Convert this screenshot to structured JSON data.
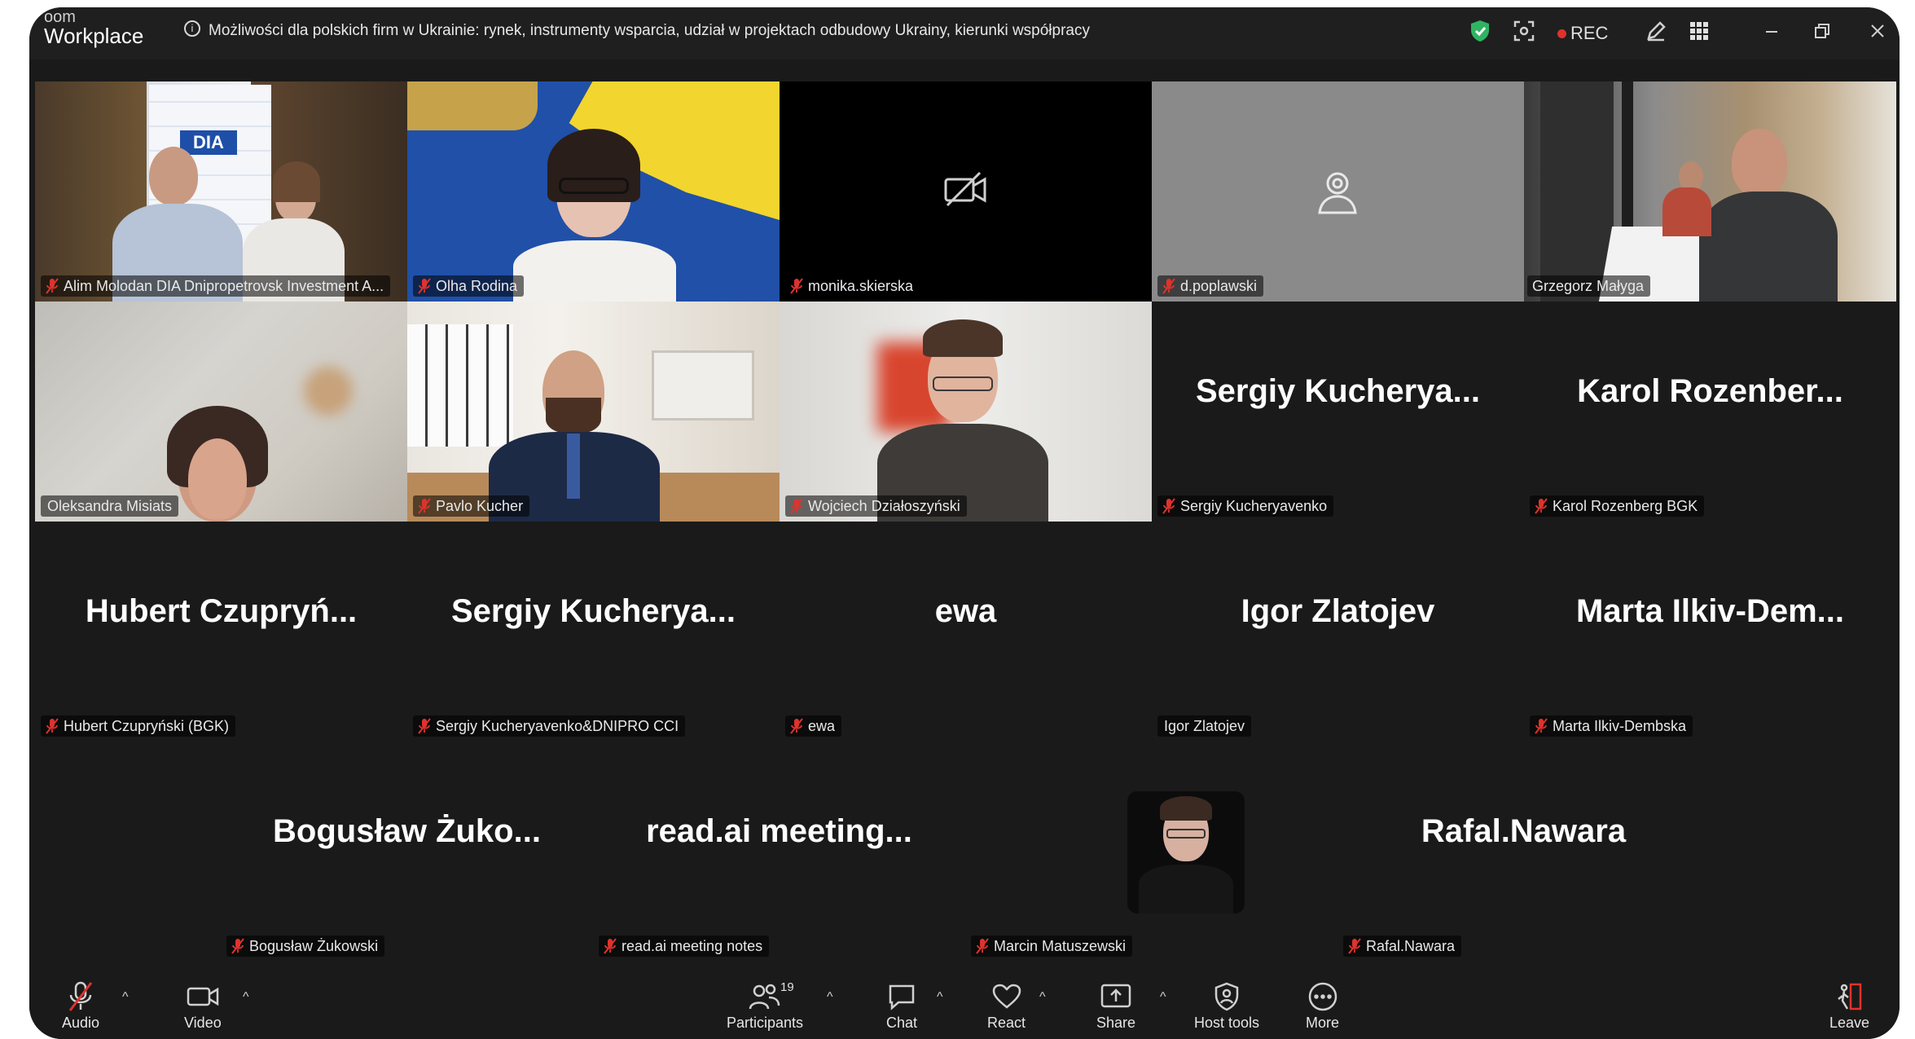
{
  "app": {
    "brand_top": "oom",
    "brand_bottom": "Workplace"
  },
  "meeting": {
    "topic": "Możliwości dla polskich firm w Ukrainie: rynek, instrumenty wsparcia, udział w projektach odbudowy Ukrainy, kierunki współpracy"
  },
  "titlebar": {
    "rec_label": "REC"
  },
  "tiles": [
    {
      "name": "Alim Molodan DIA Dnipropetrovsk Investment A...",
      "type": "video"
    },
    {
      "name": "Olha Rodina",
      "type": "video"
    },
    {
      "name": "monika.skierska",
      "type": "camera-off"
    },
    {
      "name": "d.poplawski",
      "type": "avatar-placeholder"
    },
    {
      "name": "Grzegorz Małyga",
      "type": "video",
      "active_speaker": true
    },
    {
      "name": "Oleksandra Misiats",
      "type": "video",
      "muted": false
    },
    {
      "name": "Pavlo Kucher",
      "type": "video"
    },
    {
      "name": "Wojciech Działoszyński",
      "type": "video"
    },
    {
      "name": "Sergiy Kucheryavenko",
      "display_name": "Sergiy  Kucherya...",
      "type": "name-only"
    },
    {
      "name": "Karol Rozenberg BGK",
      "display_name": "Karol  Rozenber...",
      "type": "name-only"
    },
    {
      "name": "Hubert Czupryński (BGK)",
      "display_name": "Hubert  Czupryń...",
      "type": "name-only"
    },
    {
      "name": "Sergiy Kucheryavenko&DNIPRO CCI",
      "display_name": "Sergiy  Kucherya...",
      "type": "name-only"
    },
    {
      "name": "ewa",
      "display_name": "ewa",
      "type": "name-only"
    },
    {
      "name": "Igor Zlatojev",
      "display_name": "Igor Zlatojev",
      "type": "name-only",
      "muted": false
    },
    {
      "name": "Marta Ilkiv-Dembska",
      "display_name": "Marta  Ilkiv-Dem...",
      "type": "name-only"
    },
    {
      "name": "Bogusław Żukowski",
      "display_name": "Bogusław  Żuko...",
      "type": "name-only"
    },
    {
      "name": "read.ai meeting notes",
      "display_name": "read.ai  meeting...",
      "type": "name-only"
    },
    {
      "name": "Marcin Matuszewski",
      "type": "profile-photo"
    },
    {
      "name": "Rafal.Nawara",
      "display_name": "Rafal.Nawara",
      "type": "name-only"
    }
  ],
  "toolbar": {
    "audio": "Audio",
    "video": "Video",
    "participants": "Participants",
    "participants_count": "19",
    "chat": "Chat",
    "react": "React",
    "share": "Share",
    "host_tools": "Host tools",
    "more": "More",
    "leave": "Leave"
  },
  "colors": {
    "active_speaker_border": "#3cc26b",
    "rec_dot": "#e0322c",
    "muted_icon": "#e0322c",
    "window_bg": "#1a1a1a"
  }
}
